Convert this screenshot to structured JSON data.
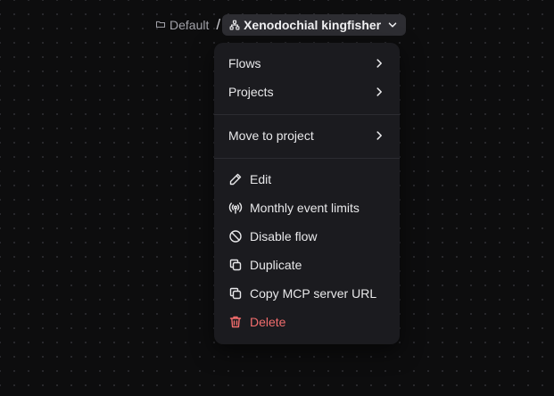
{
  "breadcrumb": {
    "project": "Default",
    "separator": "/",
    "flow_name": "Xenodochial kingfisher"
  },
  "menu": {
    "submenus": [
      {
        "label": "Flows"
      },
      {
        "label": "Projects"
      },
      {
        "label": "Move to project"
      }
    ],
    "actions": [
      {
        "label": "Edit",
        "icon": "pencil-icon"
      },
      {
        "label": "Monthly event limits",
        "icon": "broadcast-icon"
      },
      {
        "label": "Disable flow",
        "icon": "ban-icon"
      },
      {
        "label": "Duplicate",
        "icon": "copy-icon"
      },
      {
        "label": "Copy MCP server URL",
        "icon": "copy-icon"
      },
      {
        "label": "Delete",
        "icon": "trash-icon"
      }
    ]
  },
  "colors": {
    "background": "#0d0d0e",
    "menu_background": "#1b1b1f",
    "danger": "#f26d6d",
    "text": "#e8e8ea"
  }
}
